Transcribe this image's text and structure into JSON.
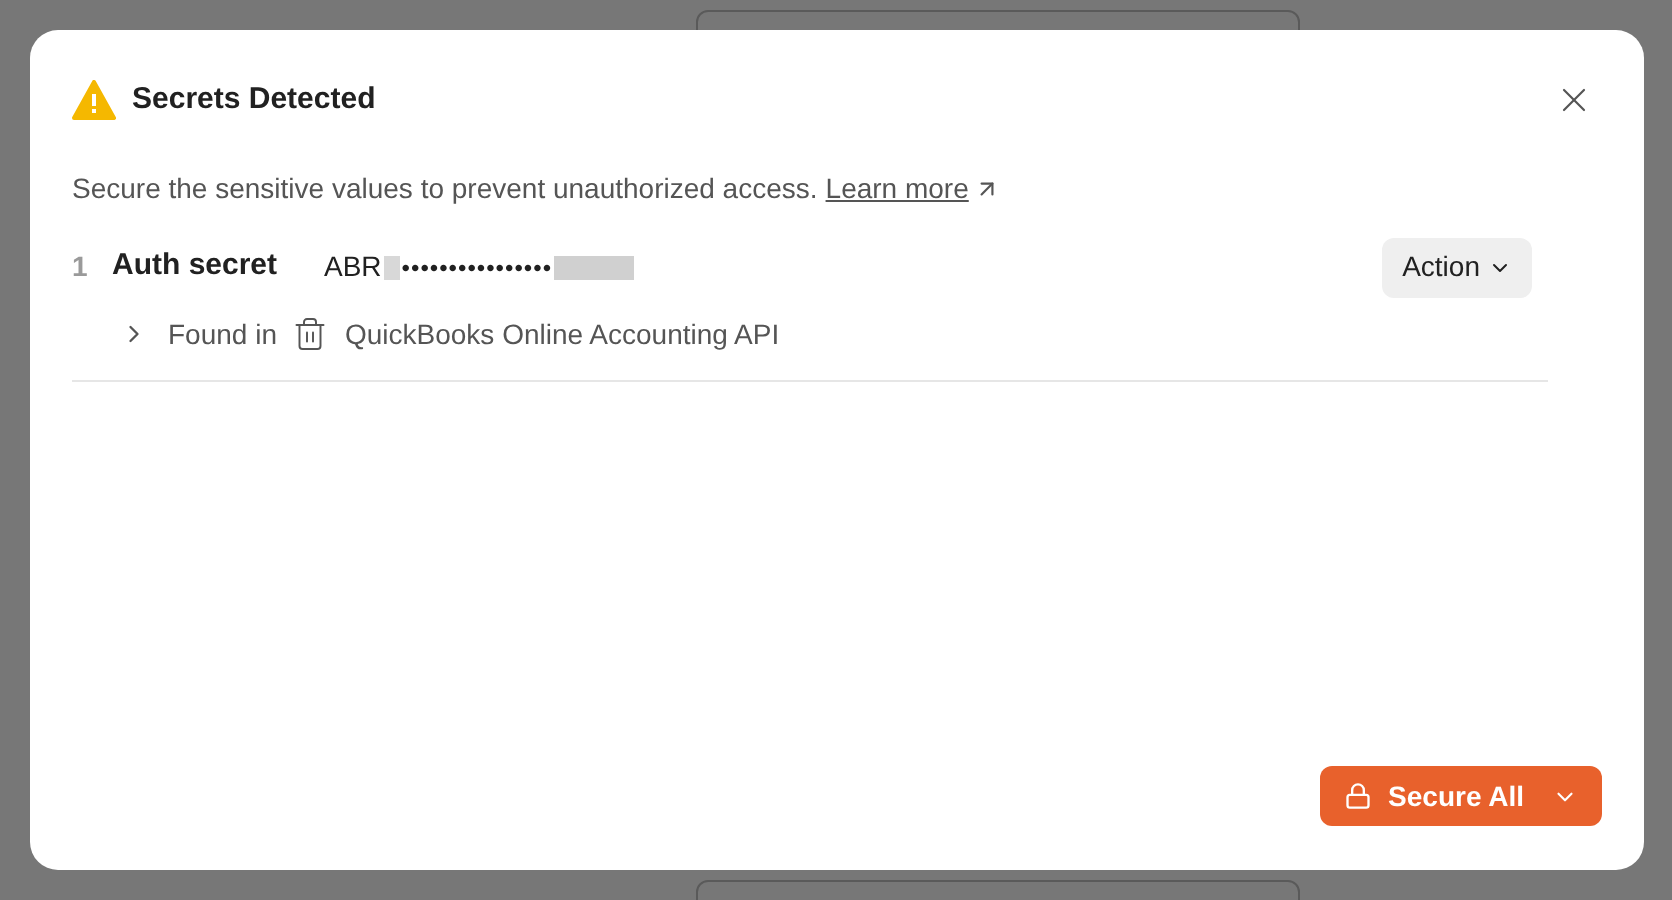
{
  "dialog": {
    "title": "Secrets Detected",
    "description": "Secure the sensitive values to prevent unauthorized access.",
    "link": "Learn more"
  },
  "secrets": [
    {
      "index": "1",
      "name": "Auth secret",
      "value_start": "ABR",
      "value_masked": "••••••••••••••••",
      "expanded": false,
      "found_in_label": "Found in",
      "found_in": "QuickBooks Online Accounting API",
      "action": "Action"
    }
  ],
  "footer": {
    "button": "Secure All"
  }
}
